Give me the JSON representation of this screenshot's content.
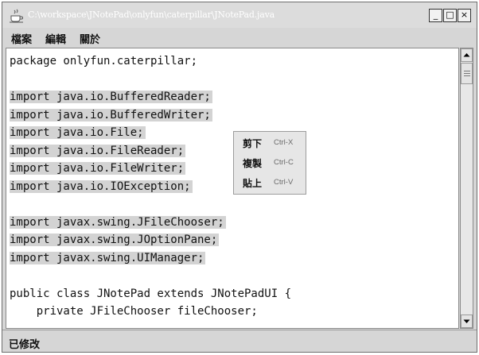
{
  "window": {
    "title": "C:\\workspace\\JNotePad\\onlyfun\\caterpillar\\JNotePad.java",
    "minimize_label": "_",
    "maximize_label": "□",
    "close_label": "×"
  },
  "menubar": {
    "items": [
      {
        "label": "檔案"
      },
      {
        "label": "編輯"
      },
      {
        "label": "關於"
      }
    ]
  },
  "editor": {
    "lines": [
      {
        "text": "package onlyfun.caterpillar;",
        "selected": false
      },
      {
        "text": "",
        "selected": false
      },
      {
        "text": "import java.io.BufferedReader;",
        "selected": true
      },
      {
        "text": "import java.io.BufferedWriter;",
        "selected": true
      },
      {
        "text": "import java.io.File;",
        "selected": true
      },
      {
        "text": "import java.io.FileReader;",
        "selected": true
      },
      {
        "text": "import java.io.FileWriter;",
        "selected": true
      },
      {
        "text": "import java.io.IOException;",
        "selected": true
      },
      {
        "text": "",
        "selected": false
      },
      {
        "text": "import javax.swing.JFileChooser;",
        "selected": true
      },
      {
        "text": "import javax.swing.JOptionPane;",
        "selected": true
      },
      {
        "text": "import javax.swing.UIManager;",
        "selected": true
      },
      {
        "text": "",
        "selected": false
      },
      {
        "text": "public class JNotePad extends JNotePadUI {",
        "selected": false
      },
      {
        "text": "    private JFileChooser fileChooser;",
        "selected": false
      }
    ],
    "selection_color": "#d3d3d3"
  },
  "context_menu": {
    "items": [
      {
        "label": "剪下",
        "shortcut": "Ctrl-X"
      },
      {
        "label": "複製",
        "shortcut": "Ctrl-C"
      },
      {
        "label": "貼上",
        "shortcut": "Ctrl-V"
      }
    ]
  },
  "statusbar": {
    "text": "已修改"
  }
}
